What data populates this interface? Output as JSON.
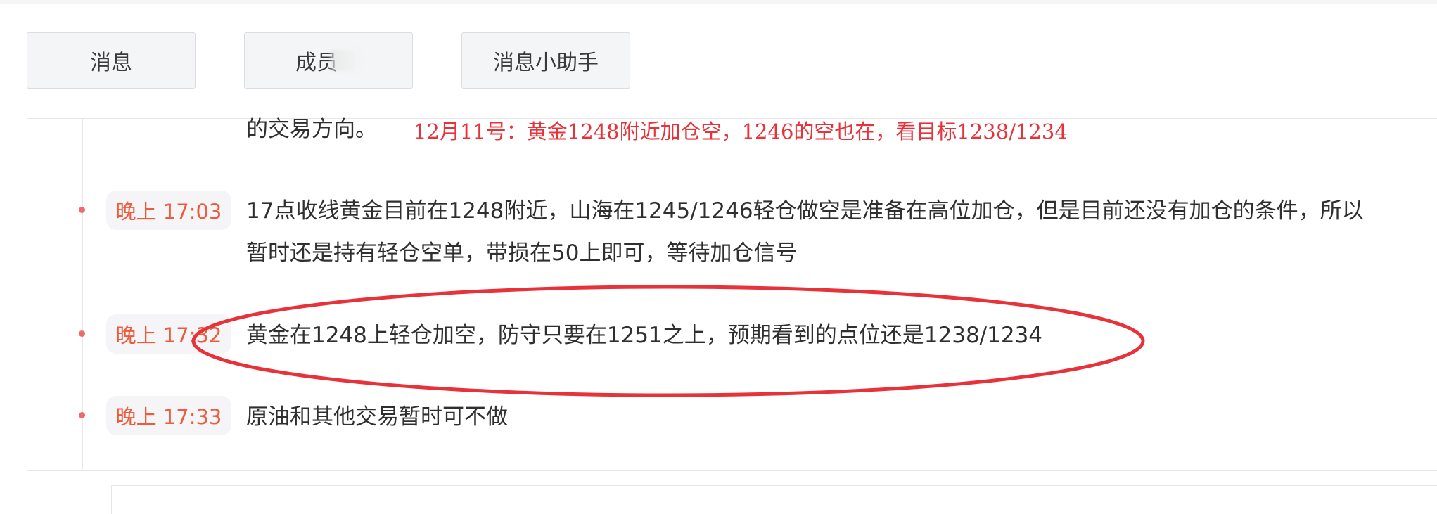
{
  "tabs": [
    {
      "label": "消息"
    },
    {
      "label": "成员"
    },
    {
      "label": "消息小助手"
    }
  ],
  "feed": {
    "first_line_text": "的交易方向。",
    "red_note": "12月11号：黄金1248附近加仓空，1246的空也在，看目标1238/1234",
    "items": [
      {
        "time": "晚上 17:03",
        "line1": "17点收线黄金目前在1248附近，山海在1245/1246轻仓做空是准备在高位加仓，但是目前还没有加仓的条件，所以",
        "line2": "暂时还是持有轻仓空单，带损在50上即可，等待加仓信号"
      },
      {
        "time": "晚上 17:32",
        "line1": "黄金在1248上轻仓加空，防守只要在1251之上，预期看到的点位还是1238/1234"
      },
      {
        "time": "晚上 17:33",
        "line1": "原油和其他交易暂时可不做"
      }
    ]
  },
  "colors": {
    "time_text": "#ee5a3c",
    "annotation_red": "#e8323a"
  }
}
